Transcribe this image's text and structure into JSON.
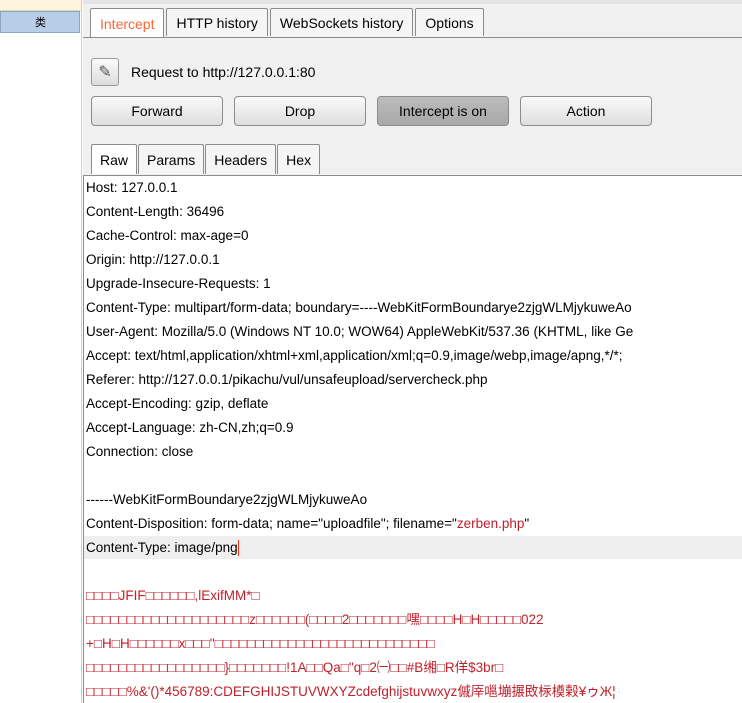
{
  "sidebar": {
    "item_label": "类"
  },
  "tabs": [
    "Intercept",
    "HTTP history",
    "WebSockets history",
    "Options"
  ],
  "request": {
    "label": "Request to http://127.0.0.1:80"
  },
  "buttons": {
    "forward": "Forward",
    "drop": "Drop",
    "intercept": "Intercept is on",
    "action": "Action"
  },
  "subtabs": [
    "Raw",
    "Params",
    "Headers",
    "Hex"
  ],
  "body": {
    "host": "Host: 127.0.0.1",
    "content_length": "Content-Length: 36496",
    "cache_control": "Cache-Control: max-age=0",
    "origin": "Origin: http://127.0.0.1",
    "upgrade": "Upgrade-Insecure-Requests: 1",
    "content_type": "Content-Type: multipart/form-data; boundary=----WebKitFormBoundarye2zjgWLMjykuweAo",
    "user_agent": "User-Agent: Mozilla/5.0 (Windows NT 10.0; WOW64) AppleWebKit/537.36 (KHTML, like Ge",
    "accept": "Accept: text/html,application/xhtml+xml,application/xml;q=0.9,image/webp,image/apng,*/*;",
    "referer": "Referer: http://127.0.0.1/pikachu/vul/unsafeupload/servercheck.php",
    "accept_encoding": "Accept-Encoding: gzip, deflate",
    "accept_language": "Accept-Language: zh-CN,zh;q=0.9",
    "connection": "Connection: close",
    "boundary": "------WebKitFormBoundarye2zjgWLMjykuweAo",
    "disposition_prefix": "Content-Disposition: form-data; name=\"uploadfile\"; filename=\"",
    "filename": "zerben.php",
    "disposition_suffix": "\"",
    "part_content_type": "Content-Type: image/png",
    "bin1": "□□□□JFIF□□□□□□,lExifMM*□",
    "bin2": "□□□□□□□□□□□□□□□□□□□□z□□□□□□(□□□□2□□□□□□□嘿□□□□H□H□□□□□022",
    "bin3": "+□H□H□□□□□□x□□□\"□□□□□□□□□□□□□□□□□□□□□□□□□□□",
    "bin4": "□□□□□□□□□□□□□□□□□}□□□□□□□!1A□□Qa□\"q□2㈠□□#B缃□R佯$3br□",
    "bin5": "□□□□□%&'()*456789:CDEFGHIJSTUVWXYZcdefghijstuvwxyz傶厗嗈塴搌敃柡橂榖¥ゥЖ¦"
  }
}
